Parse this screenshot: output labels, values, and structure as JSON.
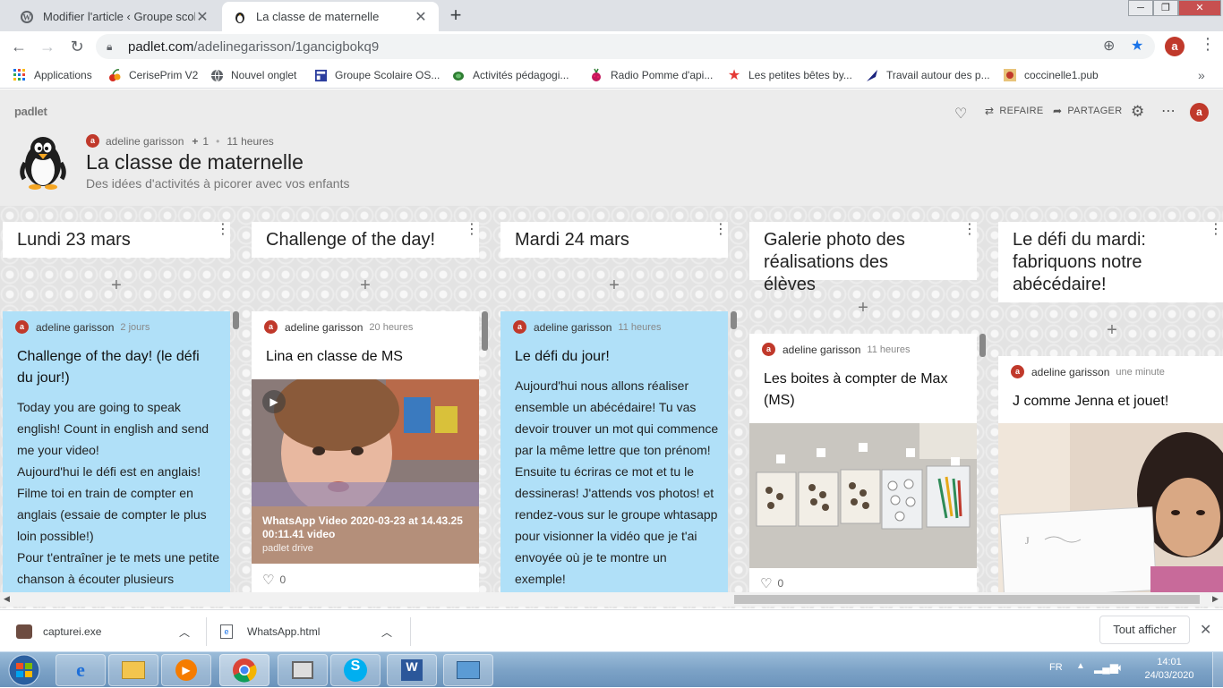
{
  "browser": {
    "tabs": [
      {
        "title": "Modifier l'article ‹ Groupe scolair",
        "active": false
      },
      {
        "title": "La classe de maternelle",
        "active": true
      }
    ],
    "url_host": "padlet.com",
    "url_path": "/adelinegarisson/1gancigbokq9",
    "profile_initial": "a"
  },
  "bookmarks": [
    {
      "label": "Applications",
      "icon": "apps-grid-icon"
    },
    {
      "label": "CerisePrim V2",
      "icon": "cherry-icon"
    },
    {
      "label": "Nouvel onglet",
      "icon": "globe-icon"
    },
    {
      "label": "Groupe Scolaire OS...",
      "icon": "site-icon"
    },
    {
      "label": "Activités pédagogi...",
      "icon": "turtle-icon"
    },
    {
      "label": "Radio Pomme d'api...",
      "icon": "raspberry-icon"
    },
    {
      "label": "Les petites bêtes by...",
      "icon": "star-icon"
    },
    {
      "label": "Travail autour des p...",
      "icon": "feather-icon"
    },
    {
      "label": "coccinelle1.pub",
      "icon": "publisher-icon"
    }
  ],
  "padlet": {
    "logo": "padlet",
    "toolbar": {
      "remake": "REFAIRE",
      "share": "PARTAGER"
    },
    "author": "adeline garisson",
    "plus_count": "1",
    "age": "11 heures",
    "title": "La classe de maternelle",
    "subtitle": "Des idées d'activités à picorer avec vos enfants",
    "avatar_initial": "a",
    "add_symbol": "+",
    "columns": [
      {
        "title": "Lundi 23 mars",
        "card": {
          "author": "adeline garisson",
          "time": "2 jours",
          "title": "Challenge of the day! (le défi du jour!)",
          "body": [
            "Today you are going to speak english! Count in english and send me your video!",
            "Aujourd'hui le défi est en anglais! Filme toi en train de compter en anglais (essaie de compter le plus loin possible!)",
            "Pour t'entraîner je te mets une petite chanson à écouter plusieurs"
          ]
        }
      },
      {
        "title": "Challenge of the day!",
        "card": {
          "author": "adeline garisson",
          "time": "20 heures",
          "title": "Lina en classe de MS",
          "video_caption": "WhatsApp Video 2020-03-23 at 14.43.25 00:11.41 video",
          "video_source": "padlet drive",
          "likes": "0"
        }
      },
      {
        "title": "Mardi 24 mars",
        "card": {
          "author": "adeline garisson",
          "time": "11 heures",
          "title": "Le défi du jour!",
          "body": [
            "Aujourd'hui nous allons réaliser ensemble un abécédaire! Tu vas devoir trouver un mot qui commence par la même lettre que ton prénom! Ensuite tu écriras ce mot et tu le dessineras! J'attends vos photos! et rendez-vous sur le groupe whtasapp pour visionner la vidéo que je t'ai envoyée où je te montre un exemple!"
          ]
        }
      },
      {
        "title": "Galerie photo des réalisations des élèves",
        "card": {
          "author": "adeline garisson",
          "time": "11 heures",
          "title": "Les boites à compter de Max (MS)",
          "likes": "0"
        }
      },
      {
        "title": "Le défi du mardi: fabriquons notre abécédaire!",
        "card": {
          "author": "adeline garisson",
          "time": "une minute",
          "title": "J comme Jenna et jouet!"
        }
      }
    ]
  },
  "downloads": [
    {
      "name": "capturei.exe"
    },
    {
      "name": "WhatsApp.html"
    }
  ],
  "downloads_show_all": "Tout afficher",
  "taskbar": {
    "language": "FR",
    "time": "14:01",
    "date": "24/03/2020"
  }
}
